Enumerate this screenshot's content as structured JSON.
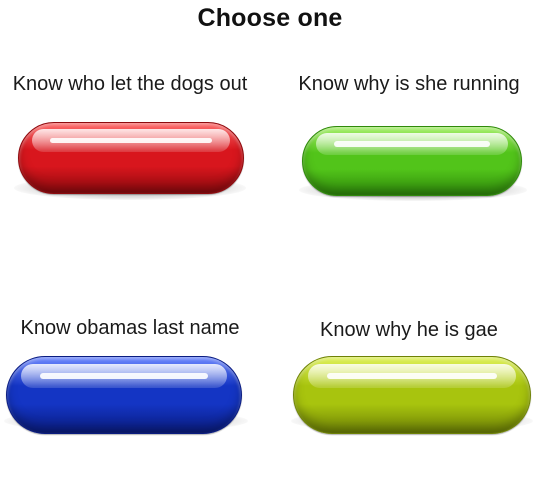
{
  "title": "Choose one",
  "options": [
    {
      "label": "Know who let the dogs out",
      "pill_color": "#d8161d",
      "pill_dark": "#8e0a0e",
      "pill_light": "#ff6b6b"
    },
    {
      "label": "Know why is she running",
      "pill_color": "#52c41a",
      "pill_dark": "#2f8a0b",
      "pill_light": "#a6f06a"
    },
    {
      "label": "Know obamas last name",
      "pill_color": "#1435c4",
      "pill_dark": "#0a1c80",
      "pill_light": "#6d88ff"
    },
    {
      "label": "Know why he is gae",
      "pill_color": "#a8c40e",
      "pill_dark": "#6e8206",
      "pill_light": "#e0f25a"
    }
  ]
}
